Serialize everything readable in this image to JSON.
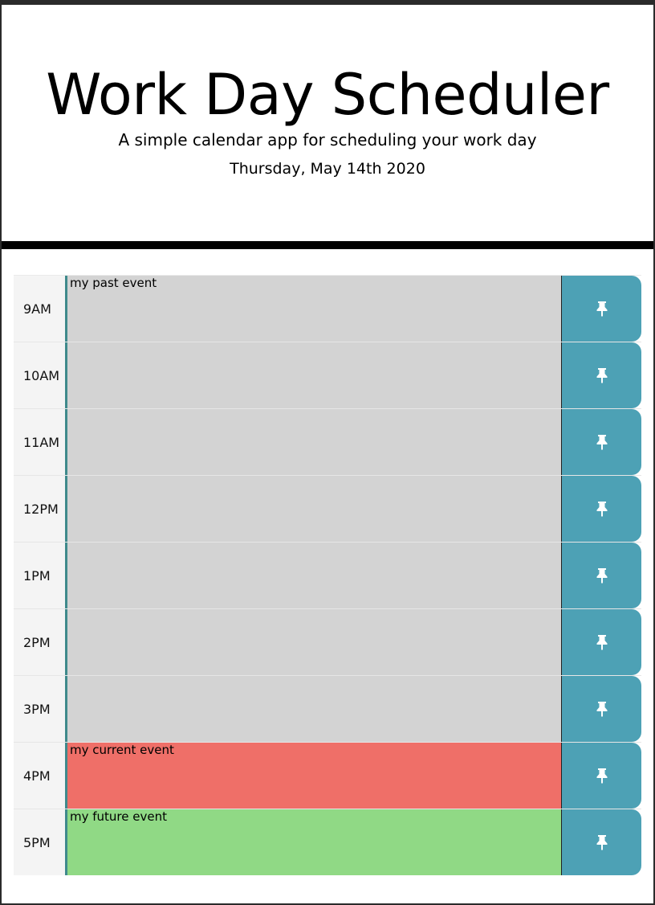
{
  "header": {
    "title": "Work Day Scheduler",
    "lead": "A simple calendar app for scheduling your work day",
    "current_day": "Thursday, May 14th 2020"
  },
  "colors": {
    "past": "#d3d3d3",
    "present": "#ef6f68",
    "future": "#90d985",
    "save_button": "#4da1b5"
  },
  "time_blocks": [
    {
      "hour": "9AM",
      "event": "my past event",
      "state": "past",
      "save_icon": "pushpin-icon"
    },
    {
      "hour": "10AM",
      "event": "",
      "state": "past",
      "save_icon": "pushpin-icon"
    },
    {
      "hour": "11AM",
      "event": "",
      "state": "past",
      "save_icon": "pushpin-icon"
    },
    {
      "hour": "12PM",
      "event": "",
      "state": "past",
      "save_icon": "pushpin-icon"
    },
    {
      "hour": "1PM",
      "event": "",
      "state": "past",
      "save_icon": "pushpin-icon"
    },
    {
      "hour": "2PM",
      "event": "",
      "state": "past",
      "save_icon": "pushpin-icon"
    },
    {
      "hour": "3PM",
      "event": "",
      "state": "past",
      "save_icon": "pushpin-icon"
    },
    {
      "hour": "4PM",
      "event": "my current event",
      "state": "present",
      "save_icon": "pushpin-icon"
    },
    {
      "hour": "5PM",
      "event": "my future event",
      "state": "future",
      "save_icon": "pushpin-icon"
    }
  ]
}
